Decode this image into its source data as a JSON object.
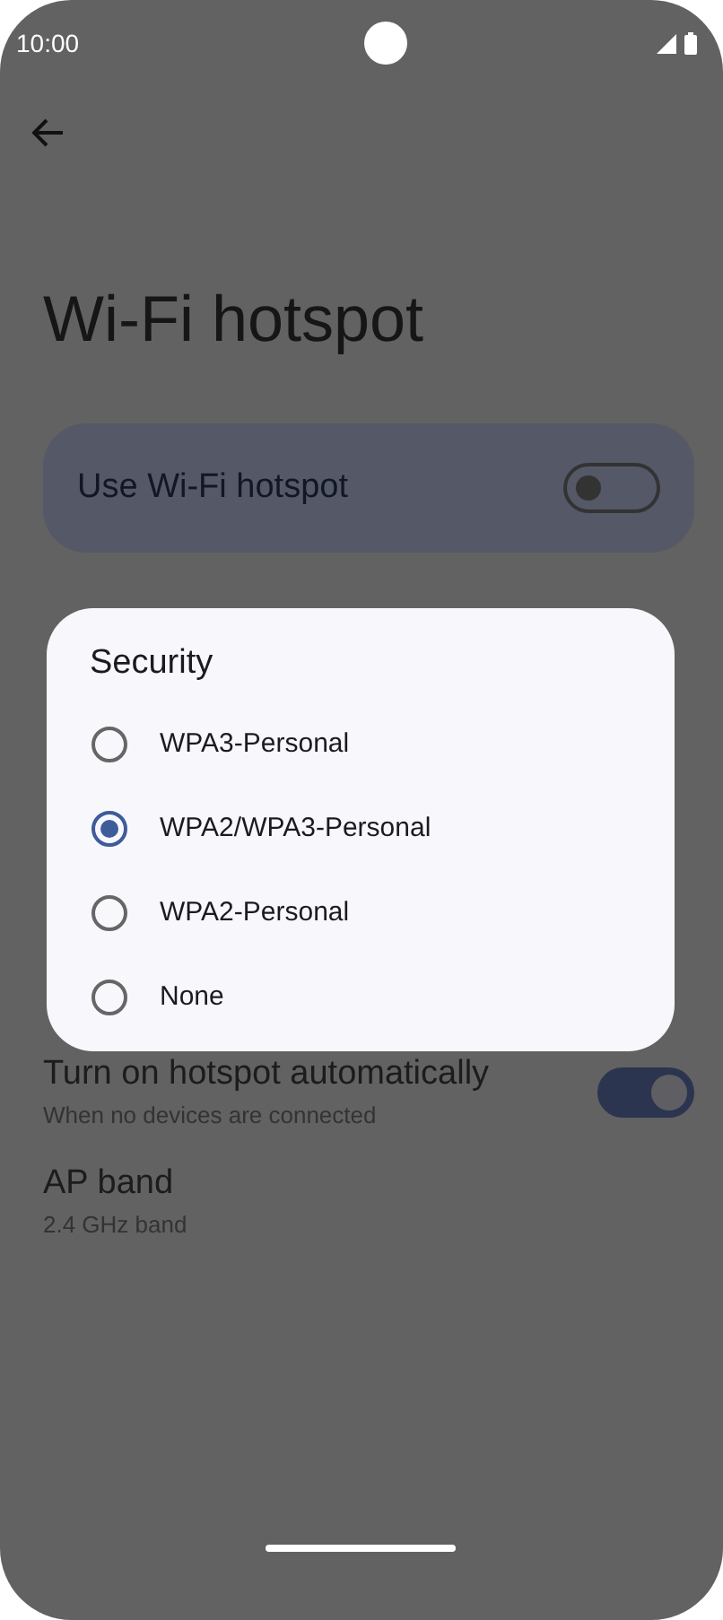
{
  "status_bar": {
    "time": "10:00"
  },
  "title": "Wi-Fi hotspot",
  "main_switch": {
    "label": "Use Wi-Fi hotspot",
    "on": false
  },
  "settings": [
    {
      "title": "Turn on hotspot automatically",
      "subtitle": "When no devices are connected",
      "kind": "switch",
      "on": true
    },
    {
      "title": "AP band",
      "subtitle": "2.4 GHz band",
      "kind": "plain"
    }
  ],
  "dialog": {
    "title": "Security",
    "options": [
      {
        "label": "WPA3-Personal",
        "selected": false
      },
      {
        "label": "WPA2/WPA3-Personal",
        "selected": true
      },
      {
        "label": "WPA2-Personal",
        "selected": false
      },
      {
        "label": "None",
        "selected": false
      }
    ]
  }
}
